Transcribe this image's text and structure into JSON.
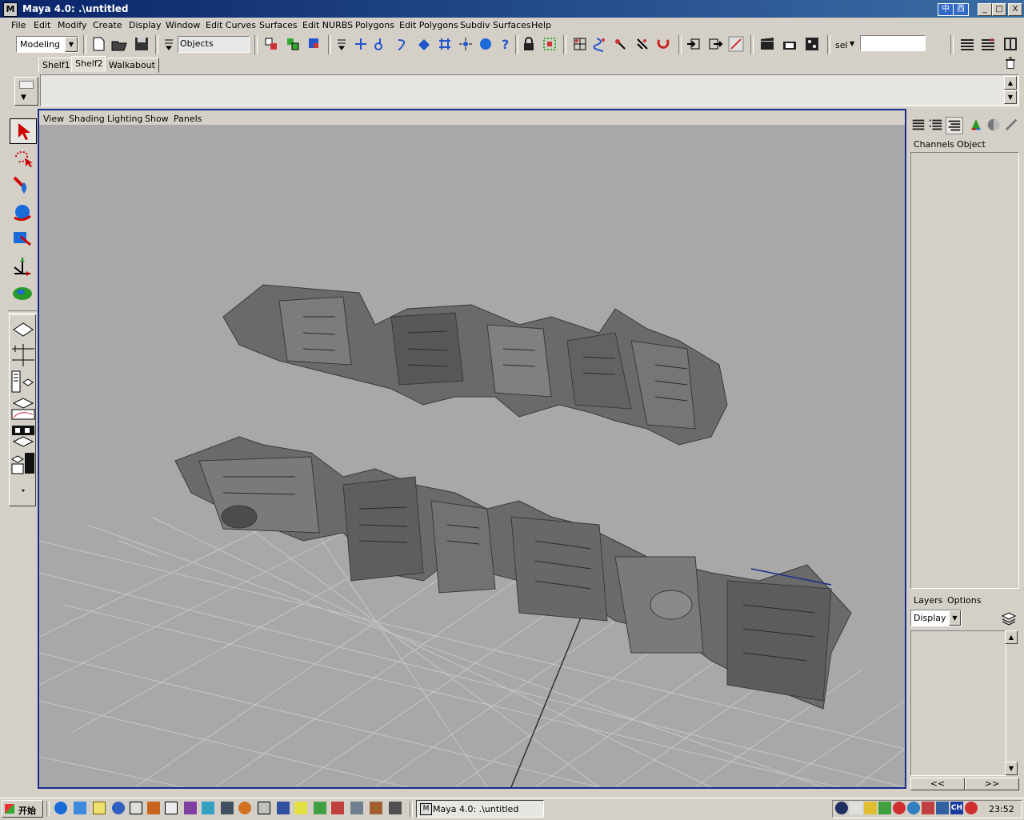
{
  "window": {
    "title": "Maya 4.0: .\\untitled",
    "ime": [
      "中",
      "西"
    ],
    "controls": [
      "_",
      "□",
      "X"
    ]
  },
  "menu": [
    "File",
    "Edit",
    "Modify",
    "Create",
    "Display",
    "Window",
    "Edit Curves",
    "Surfaces",
    "Edit NURBS",
    "Polygons",
    "Edit Polygons",
    "Subdiv Surfaces",
    "Help"
  ],
  "statusline": {
    "mode_select": "Modeling",
    "selection_mask": "Objects",
    "sel_label": "sel",
    "sel_field_value": ""
  },
  "shelf": {
    "tabs": [
      "Shelf1",
      "Shelf2",
      "Walkabout"
    ],
    "active": "Shelf2"
  },
  "viewport": {
    "menu": [
      "View",
      "Shading",
      "Lighting",
      "Show",
      "Panels"
    ]
  },
  "channelbox": {
    "menu": [
      "Channels",
      "Object"
    ]
  },
  "layers": {
    "menu": [
      "Layers",
      "Options"
    ],
    "display_select": "Display",
    "scroll_left": "<<",
    "scroll_right": ">>"
  },
  "taskbar": {
    "start_label": "开始",
    "task_button": "Maya 4.0: .\\untitled",
    "clock": "23:52",
    "tray_text": "CH"
  },
  "colors": {
    "titlebar": "#0a246a",
    "viewport_bg": "#a8a8a8",
    "viewport_border": "#1a2c8c",
    "mesh": "#6a6a6a"
  }
}
